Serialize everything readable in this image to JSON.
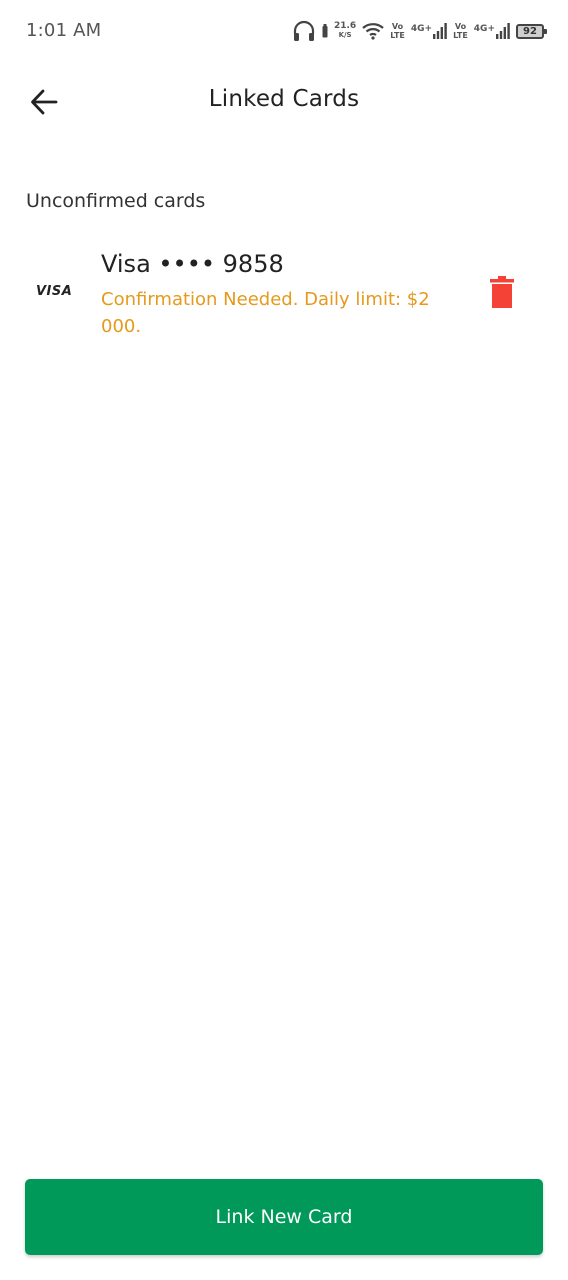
{
  "status_bar": {
    "time": "1:01 AM",
    "net_speed_value": "21.6",
    "net_speed_unit": "K/S",
    "sim1_volte_top": "Vo",
    "sim1_volte_bottom": "LTE",
    "sim1_network": "4G+",
    "sim2_volte_top": "Vo",
    "sim2_volte_bottom": "LTE",
    "sim2_network": "4G+",
    "battery_level": "92"
  },
  "app_bar": {
    "title": "Linked Cards",
    "back_icon": "arrow-left-icon"
  },
  "section": {
    "heading": "Unconfirmed cards"
  },
  "cards": [
    {
      "brand": "VISA",
      "number": "Visa •••• 9858",
      "status": "Confirmation Needed. Daily limit: $2 000.",
      "delete_icon": "trash-icon"
    }
  ],
  "footer": {
    "link_button_label": "Link New Card"
  },
  "colors": {
    "primary_green": "#00995a",
    "warning_orange": "#e59a1c",
    "delete_red": "#f44336"
  }
}
